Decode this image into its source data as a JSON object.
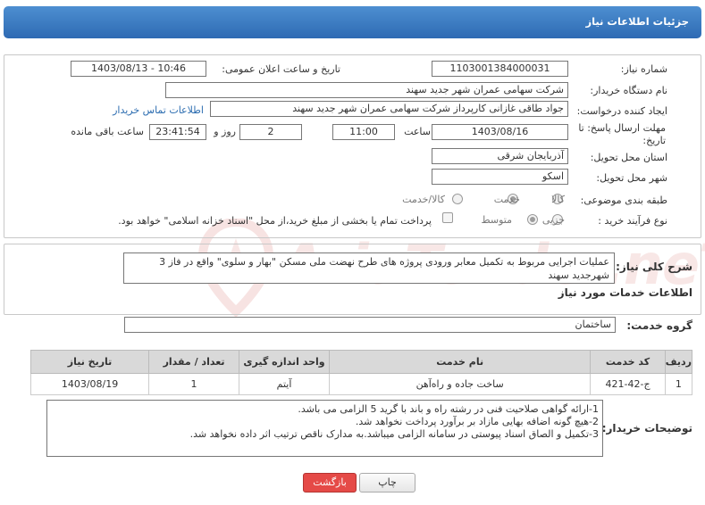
{
  "header": {
    "title": "جزئیات اطلاعات نیاز"
  },
  "form": {
    "need_number": {
      "label": "شماره نیاز:",
      "value": "1103001384000031"
    },
    "announce_datetime": {
      "label": "تاریخ و ساعت اعلان عمومی:",
      "value": "1403/08/13 - 10:46"
    },
    "buyer_org": {
      "label": "نام دستگاه خریدار:",
      "value": "شرکت سهامی عمران شهر جدید سهند"
    },
    "requester": {
      "label": "ایجاد کننده درخواست:",
      "value": "جواد طاقی غازانی کارپرداز شرکت سهامی عمران شهر جدید سهند",
      "contact_link": "اطلاعات تماس خریدار"
    },
    "deadline": {
      "label_line1": "مهلت ارسال پاسخ: تا",
      "label_line2": "تاریخ:",
      "date": "1403/08/16",
      "time_label": "ساعت",
      "time": "11:00",
      "days": "2",
      "days_label": "روز و",
      "remaining": "23:41:54",
      "remaining_label": "ساعت باقی مانده"
    },
    "province": {
      "label": "استان محل تحویل:",
      "value": "آذربایجان شرقی"
    },
    "city": {
      "label": "شهر محل تحویل:",
      "value": "اسکو"
    },
    "category": {
      "label": "طبقه بندی موضوعی:",
      "options": [
        "کالا",
        "خدمت",
        "کالا/خدمت"
      ],
      "selected": "خدمت"
    },
    "purchase_type": {
      "label": "نوع فرآیند خرید :",
      "options": [
        "جزیی",
        "متوسط"
      ],
      "selected": "متوسط",
      "treasury_note": "پرداخت تمام یا بخشی از مبلغ خرید،از محل \"اسناد خزانه اسلامی\" خواهد بود."
    }
  },
  "summary": {
    "label": "شرح کلی نیاز:",
    "text": "عملیات اجرایی مربوط به تکمیل معابر ورودی پروژه های طرح نهضت ملی مسکن \"بهار و سلوی\" واقع در فاز 3 شهرجدید سهند",
    "services_title": "اطلاعات خدمات مورد نیاز",
    "service_group_label": "گروه خدمت:",
    "service_group_value": "ساختمان"
  },
  "table": {
    "headers": [
      "ردیف",
      "کد خدمت",
      "نام خدمت",
      "واحد اندازه گیری",
      "تعداد / مقدار",
      "تاریخ نیاز"
    ],
    "rows": [
      [
        "1",
        "ج-42-421",
        "ساخت جاده و راه‌آهن",
        "آیتم",
        "1",
        "1403/08/19"
      ]
    ]
  },
  "buyer_notes": {
    "label": "توضیحات خریدار:",
    "lines": [
      "1-ارائه گواهی صلاحیت فنی در رشته راه و باند با گرید 5 الزامی می باشد.",
      "2-هیچ گونه اضافه بهایی مازاد بر برآورد پرداخت نخواهد شد.",
      "3-تکمیل و الصاق اسناد پیوستی در سامانه الزامی میباشد.به مدارک ناقص ترتیب اثر داده نخواهد شد."
    ]
  },
  "buttons": {
    "print": "چاپ",
    "back": "بازگشت"
  },
  "watermark": {
    "text": "AriaTender.neT"
  },
  "colors": {
    "header_blue": "#3b7cc6",
    "back_red": "#e54a47"
  }
}
